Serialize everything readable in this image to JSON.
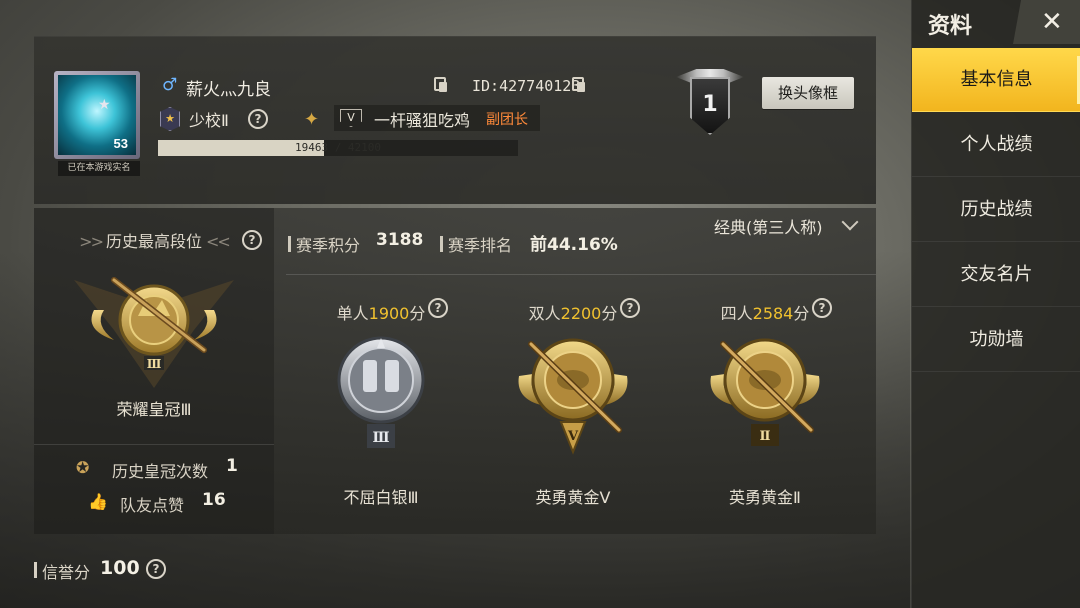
{
  "profile": {
    "avatar_level": "53",
    "real_name_status": "已在本游戏实名",
    "gender_icon": "male-icon",
    "player_name": "薪火灬九良",
    "player_id": "ID:427740123",
    "rank_title": "少校Ⅱ",
    "clan_name": "一杆骚狙吃鸡",
    "clan_role": "副团长",
    "xp_text": "19463 / 42100",
    "xp_progress": 0.462,
    "season_tier": "1",
    "change_frame_label": "换头像框"
  },
  "history": {
    "header": "历史最高段位",
    "best_tier_name": "荣耀皇冠Ⅲ",
    "crown_count_label": "历史皇冠次数",
    "crown_count_value": "1",
    "likes_label": "队友点赞",
    "likes_value": "16"
  },
  "season": {
    "mode": "经典(第三人称)",
    "points_label": "赛季积分",
    "points_value": "3188",
    "rank_label": "赛季排名",
    "rank_value": "前44.16%"
  },
  "modes": [
    {
      "prefix": "单人",
      "points": "1900",
      "suffix": "分",
      "tier_name": "不屈白银Ⅲ",
      "roman": "Ⅲ",
      "tier_color": "silver"
    },
    {
      "prefix": "双人",
      "points": "2200",
      "suffix": "分",
      "tier_name": "英勇黄金Ⅴ",
      "roman": "Ⅴ",
      "tier_color": "gold"
    },
    {
      "prefix": "四人",
      "points": "2584",
      "suffix": "分",
      "tier_name": "英勇黄金Ⅱ",
      "roman": "Ⅱ",
      "tier_color": "gold"
    }
  ],
  "credit": {
    "label": "信誉分",
    "value": "100"
  },
  "sidebar": {
    "title": "资料",
    "items": [
      {
        "label": "基本信息",
        "active": true
      },
      {
        "label": "个人战绩",
        "active": false
      },
      {
        "label": "历史战绩",
        "active": false
      },
      {
        "label": "交友名片",
        "active": false
      },
      {
        "label": "功勋墙",
        "active": false
      }
    ]
  },
  "colors": {
    "accent_gold": "#f0c12f",
    "active_tab": "#f5c12a",
    "clan_role": "#ff8a3a",
    "gender_male": "#6fb6ff"
  }
}
